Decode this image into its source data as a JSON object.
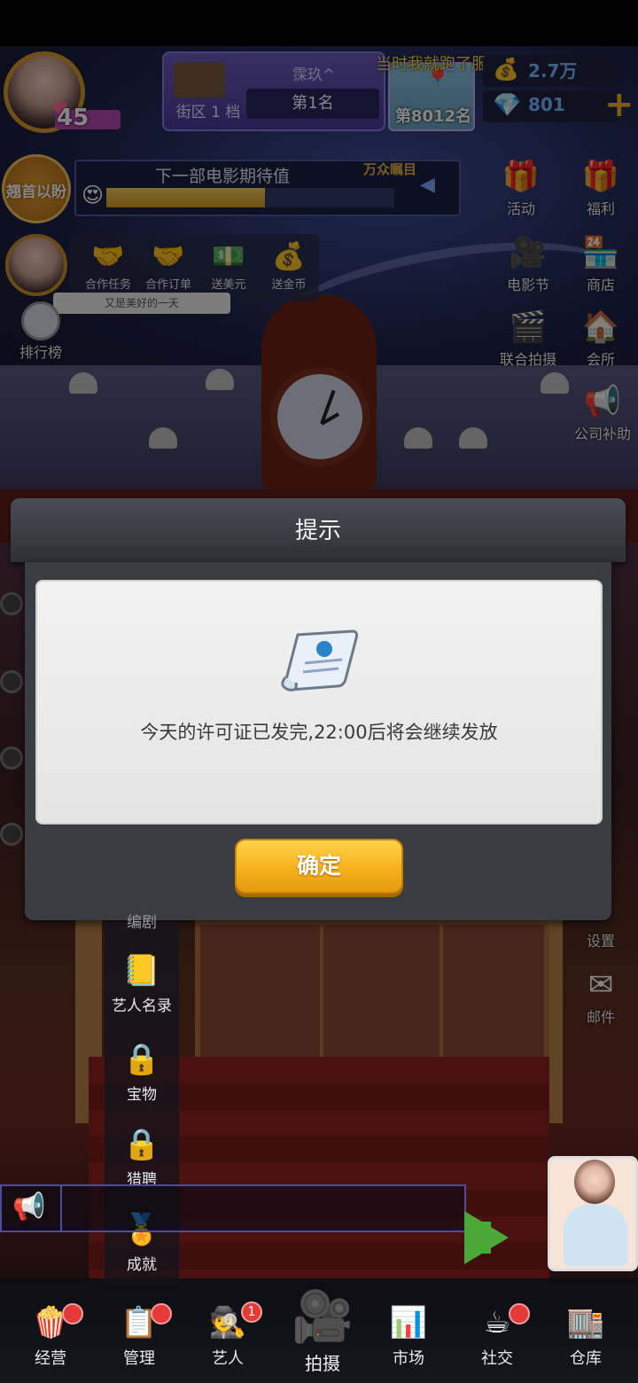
{
  "hud": {
    "level": "45",
    "district_level": "街区 1 档",
    "player_name": "霂玖^",
    "rank": "第1名",
    "marquee": "当时我就跑了服",
    "map_rank": "第8012名",
    "gold": "2.7万",
    "gems": "801"
  },
  "expectation": {
    "badge": "翘首以盼",
    "title": "下一部电影期待值",
    "tag": "万众瞩目",
    "progress_fraction": 0.55
  },
  "quick_actions": [
    {
      "label": "合作任务",
      "icon": "handshake-icon"
    },
    {
      "label": "合作订单",
      "icon": "handshake-order-icon"
    },
    {
      "label": "送美元",
      "icon": "dollar-icon"
    },
    {
      "label": "送金币",
      "icon": "coins-icon"
    }
  ],
  "speech": "又是美好的一天",
  "left_side": {
    "rank_label": "排行榜"
  },
  "right_side": [
    {
      "label": "活动",
      "icon": "gift-icon"
    },
    {
      "label": "福利",
      "icon": "present-icon"
    },
    {
      "label": "电影节",
      "icon": "camera-icon"
    },
    {
      "label": "商店",
      "icon": "shop-icon"
    },
    {
      "label": "联合拍摄",
      "icon": "clapper-icon"
    },
    {
      "label": "会所",
      "icon": "club-icon"
    },
    {
      "label": "公司补助",
      "icon": "subsidy-icon"
    },
    {
      "label": "设置",
      "icon": "gear-icon"
    },
    {
      "label": "邮件",
      "icon": "mail-icon"
    }
  ],
  "dialog": {
    "title": "提示",
    "message": "今天的许可证已发完,22:00后将会继续发放",
    "ok_label": "确定"
  },
  "left_menu": [
    {
      "label": "编剧",
      "icon": "script-icon"
    },
    {
      "label": "艺人名录",
      "icon": "directory-icon"
    },
    {
      "label": "宝物",
      "icon": "treasure-lock-icon"
    },
    {
      "label": "猎聘",
      "icon": "headhunt-lock-icon"
    },
    {
      "label": "成就",
      "icon": "achievement-icon"
    }
  ],
  "bottom_nav": [
    {
      "label": "经营",
      "icon": "popcorn-icon"
    },
    {
      "label": "管理",
      "icon": "manage-icon"
    },
    {
      "label": "艺人",
      "icon": "artist-icon",
      "badge": "1"
    },
    {
      "label": "拍摄",
      "icon": "film-camera-icon"
    },
    {
      "label": "市场",
      "icon": "market-icon"
    },
    {
      "label": "社交",
      "icon": "coffee-icon"
    },
    {
      "label": "仓库",
      "icon": "warehouse-icon"
    }
  ],
  "colors": {
    "accent_gold": "#f6b21a",
    "currency_blue": "#7ab8ff",
    "badge_red": "#e53a3a",
    "dialog_bg": "#3a3c42"
  }
}
